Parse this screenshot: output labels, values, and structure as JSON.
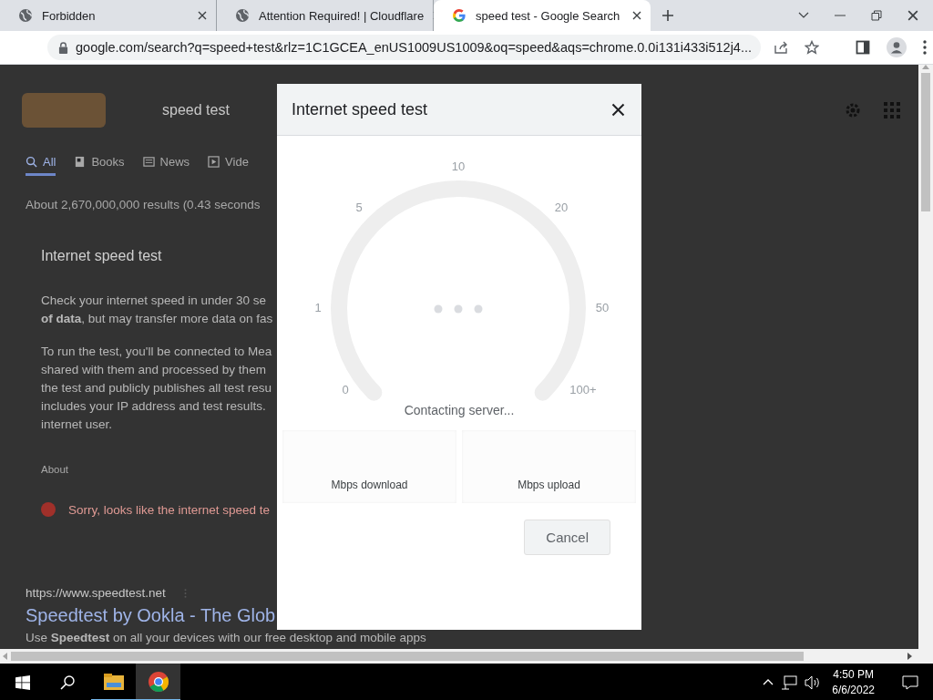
{
  "browser": {
    "tabs": [
      {
        "title": "Forbidden",
        "selected": false
      },
      {
        "title": "Attention Required! | Cloudflare",
        "selected": false
      },
      {
        "title": "speed test - Google Search",
        "selected": true
      }
    ],
    "address": "google.com/search?q=speed+test&rlz=1C1GCEA_enUS1009US1009&oq=speed&aqs=chrome.0.0i131i433i512j4..."
  },
  "page": {
    "query": "speed test",
    "nav": [
      {
        "label": "All",
        "selected": true
      },
      {
        "label": "Books",
        "selected": false
      },
      {
        "label": "News",
        "selected": false
      },
      {
        "label": "Vide",
        "selected": false
      }
    ],
    "result_stats": "About 2,670,000,000 results (0.43 seconds",
    "card_title": "Internet speed test",
    "paragraphs": [
      "Check your internet speed in under 30 se\n**of data**, but may transfer more data on fas",
      "To run the test, you'll be connected to Mea\nshared with them and processed by them\nthe test and publicly publishes all test resu\nincludes your IP address and test results.\ninternet user."
    ],
    "about": "About",
    "error": "Sorry, looks like the internet speed te",
    "result": {
      "url": "https://www.speedtest.net",
      "title": "Speedtest by Ookla - The Glob",
      "snippet": "Use **Speedtest** on all your devices with our free desktop and mobile apps"
    }
  },
  "dialog": {
    "title": "Internet speed test",
    "ticks": [
      "0",
      "1",
      "5",
      "10",
      "20",
      "50",
      "100+"
    ],
    "status": "Contacting server...",
    "readouts": [
      "Mbps download",
      "Mbps upload"
    ],
    "cancel": "Cancel"
  },
  "taskbar": {
    "apps": [
      {
        "kind": "explorer",
        "selected": false
      },
      {
        "kind": "chrome",
        "selected": true
      }
    ],
    "time": "4:50 PM",
    "date": "6/6/2022"
  }
}
